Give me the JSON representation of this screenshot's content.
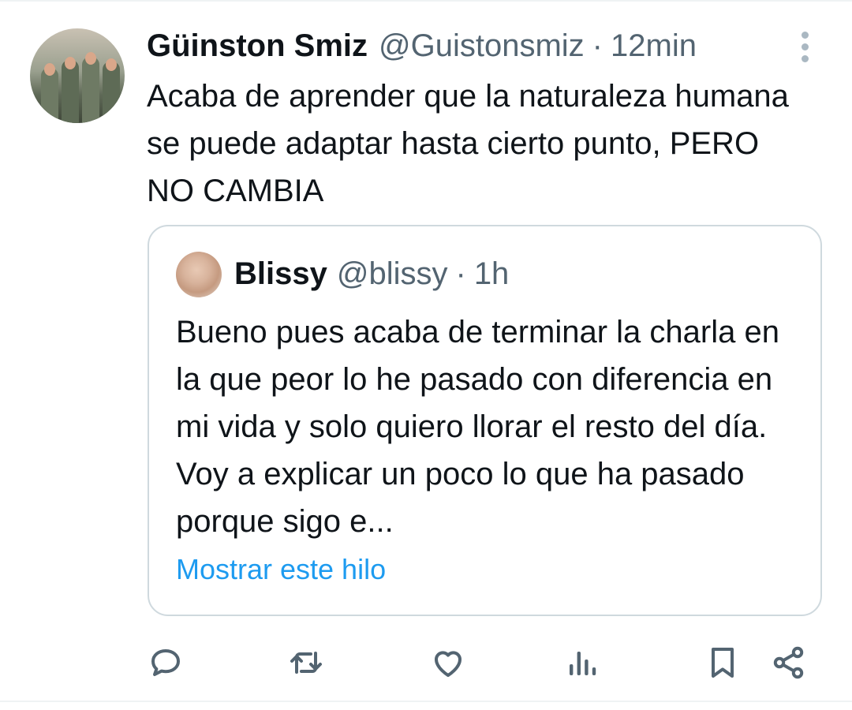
{
  "tweet": {
    "author_name": "Güinston Smiz",
    "author_handle": "@Guistonsmiz",
    "separator": "·",
    "time": "12min",
    "text": "Acaba de aprender que la naturaleza humana se puede adaptar hasta cierto punto, PERO NO CAMBIA"
  },
  "quoted_tweet": {
    "author_name": "Blissy",
    "author_handle": "@blissy",
    "separator": "·",
    "time": "1h",
    "text": "Bueno pues acaba de terminar la charla en la que peor lo he pasado con diferencia en mi vida y solo quiero llorar el resto del día. Voy a explicar un poco lo que ha pasado porque sigo e...",
    "show_thread_label": "Mostrar este hilo"
  },
  "actions": {
    "icons": [
      "reply-icon",
      "retweet-icon",
      "like-icon",
      "views-icon",
      "bookmark-icon",
      "share-icon"
    ]
  },
  "colors": {
    "text_primary": "#0f1419",
    "text_secondary": "#536471",
    "link": "#1d9bf0",
    "border": "#cfd9de",
    "icon": "#536471"
  }
}
